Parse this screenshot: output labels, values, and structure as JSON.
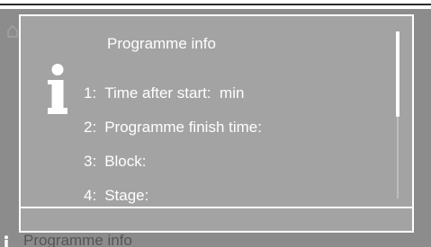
{
  "background": {
    "footer_label": "Programme info"
  },
  "dialog": {
    "title": "Programme info",
    "info_icon": "info-icon",
    "items": [
      {
        "number": "1:",
        "label": "Time after start:",
        "value": "min"
      },
      {
        "number": "2:",
        "label": "Programme finish time:",
        "value": ""
      },
      {
        "number": "3:",
        "label": "Block:",
        "value": ""
      },
      {
        "number": "4:",
        "label": "Stage:",
        "value": ""
      }
    ]
  },
  "colors": {
    "screen_background": "#8c8c8c",
    "dialog_background": "#a3a3a3",
    "text": "#ffffff"
  }
}
